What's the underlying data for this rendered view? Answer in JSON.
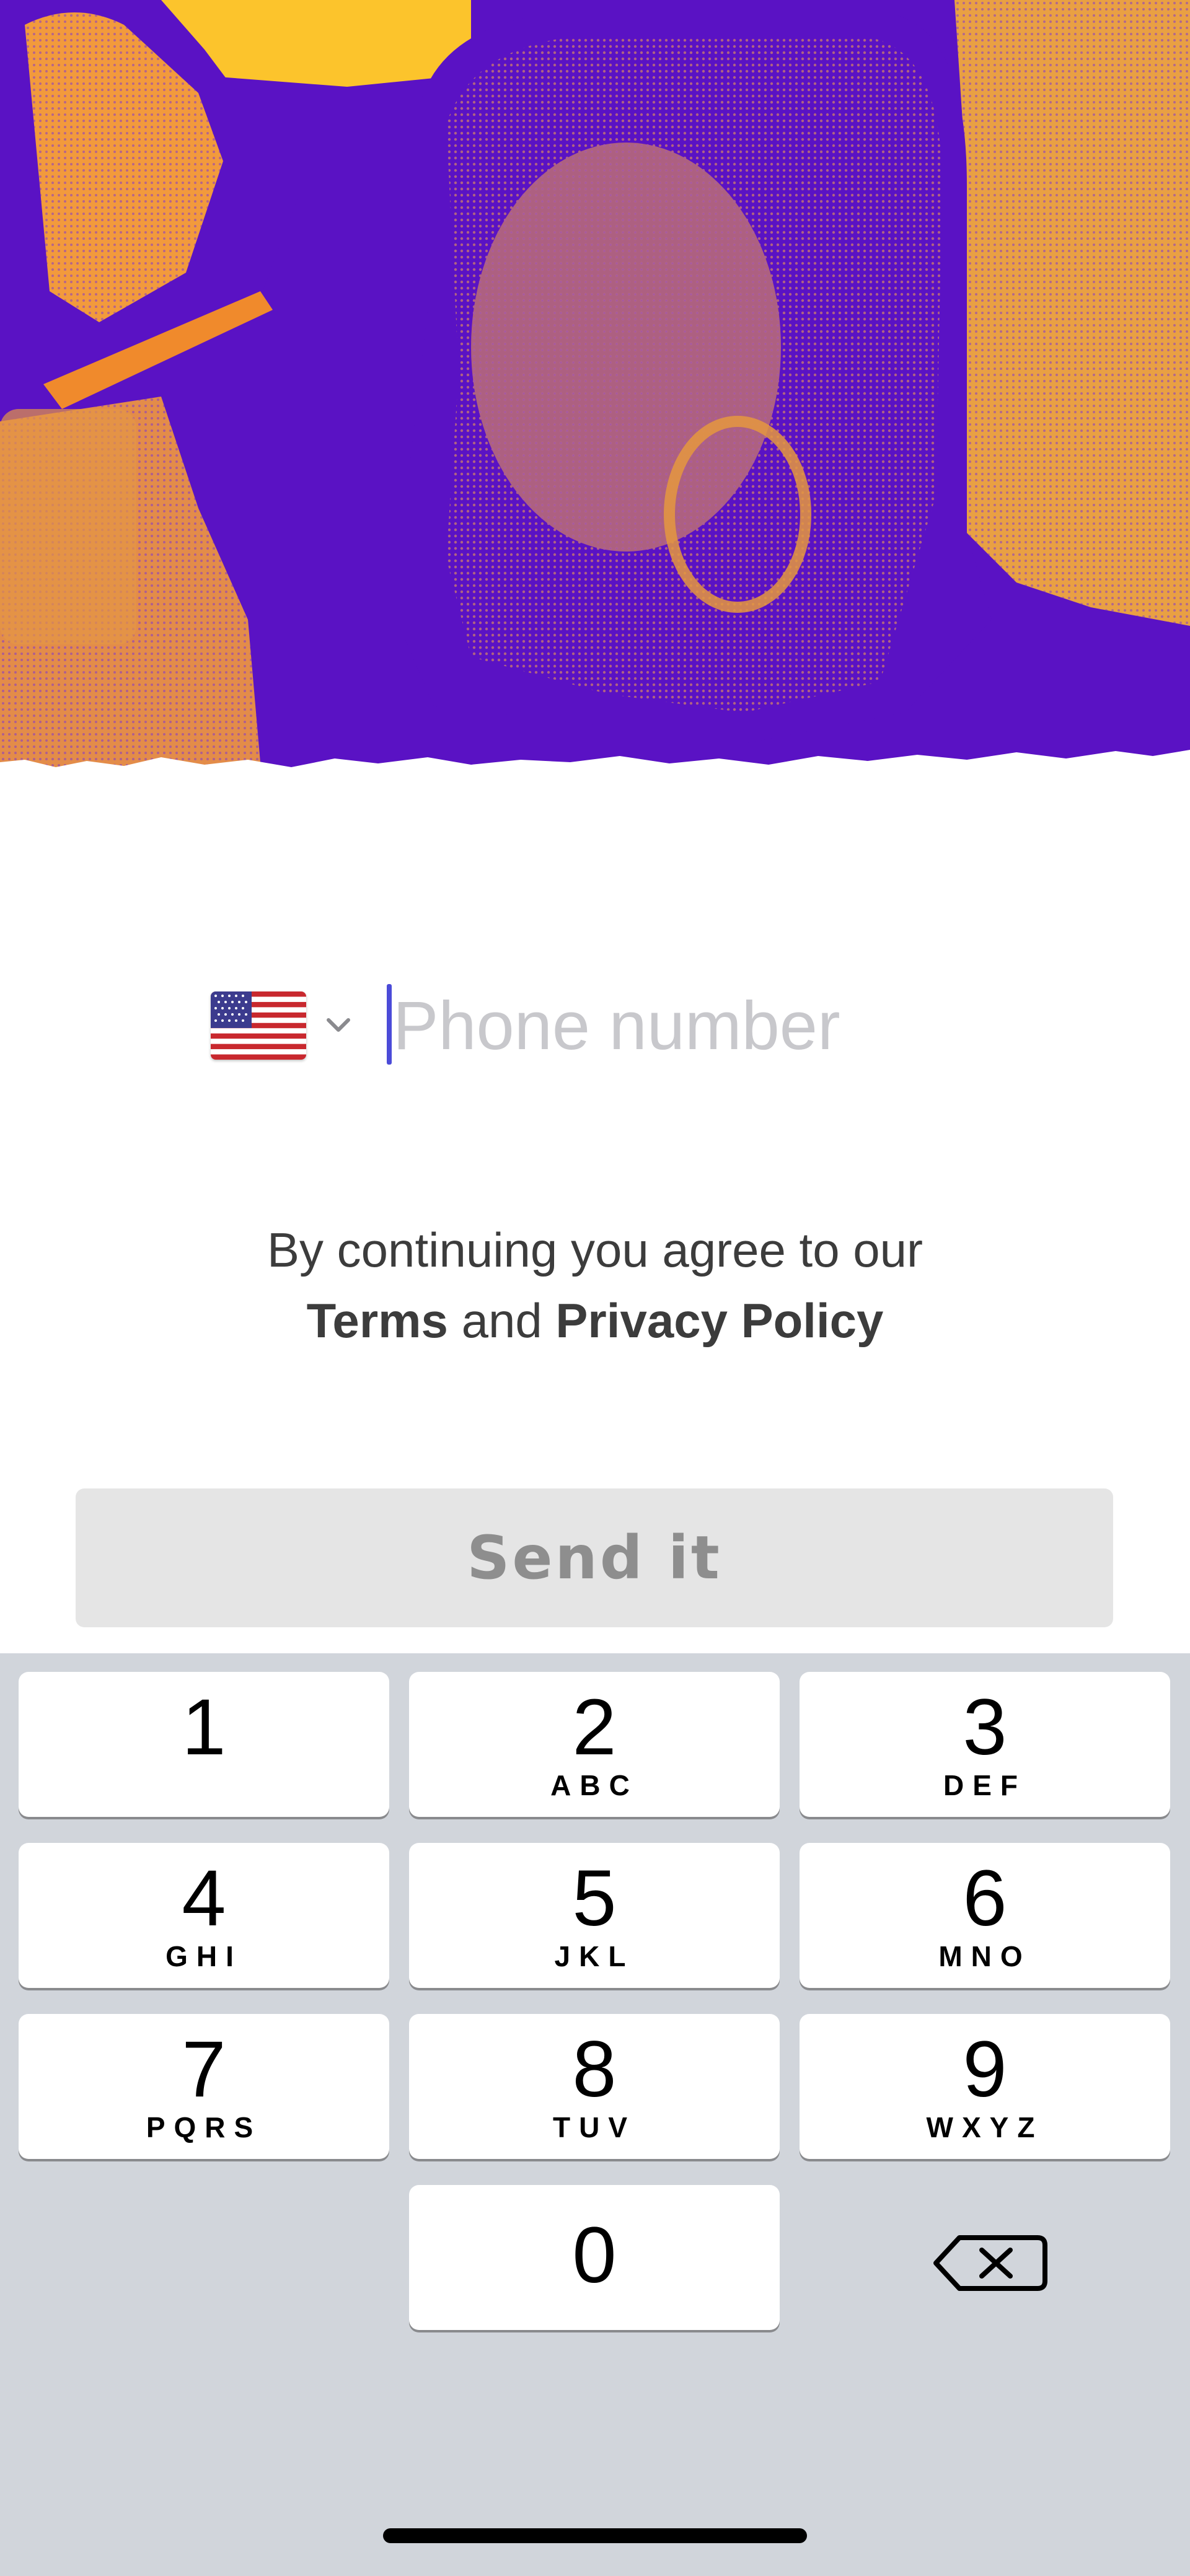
{
  "phone": {
    "country_flag": "us-flag-icon",
    "placeholder": "Phone number",
    "value": ""
  },
  "legal": {
    "line1": "By continuing you agree to our",
    "terms": "Terms",
    "and": "and",
    "privacy": "Privacy Policy"
  },
  "send_button": {
    "label": "Send it",
    "state": "disabled"
  },
  "keypad": {
    "keys": [
      {
        "digit": "1",
        "letters": ""
      },
      {
        "digit": "2",
        "letters": "ABC"
      },
      {
        "digit": "3",
        "letters": "DEF"
      },
      {
        "digit": "4",
        "letters": "GHI"
      },
      {
        "digit": "5",
        "letters": "JKL"
      },
      {
        "digit": "6",
        "letters": "MNO"
      },
      {
        "digit": "7",
        "letters": "PQRS"
      },
      {
        "digit": "8",
        "letters": "TUV"
      },
      {
        "digit": "9",
        "letters": "WXYZ"
      },
      {
        "digit": "0",
        "letters": ""
      }
    ],
    "backspace_icon": "backspace-icon"
  },
  "colors": {
    "hero_purple": "#5a12c4",
    "hero_orange": "#f29a3c",
    "hero_yellow": "#fcc42c",
    "caret": "#4b4bd8",
    "button_bg": "#e5e5e5",
    "keypad_bg": "#d1d5db"
  }
}
